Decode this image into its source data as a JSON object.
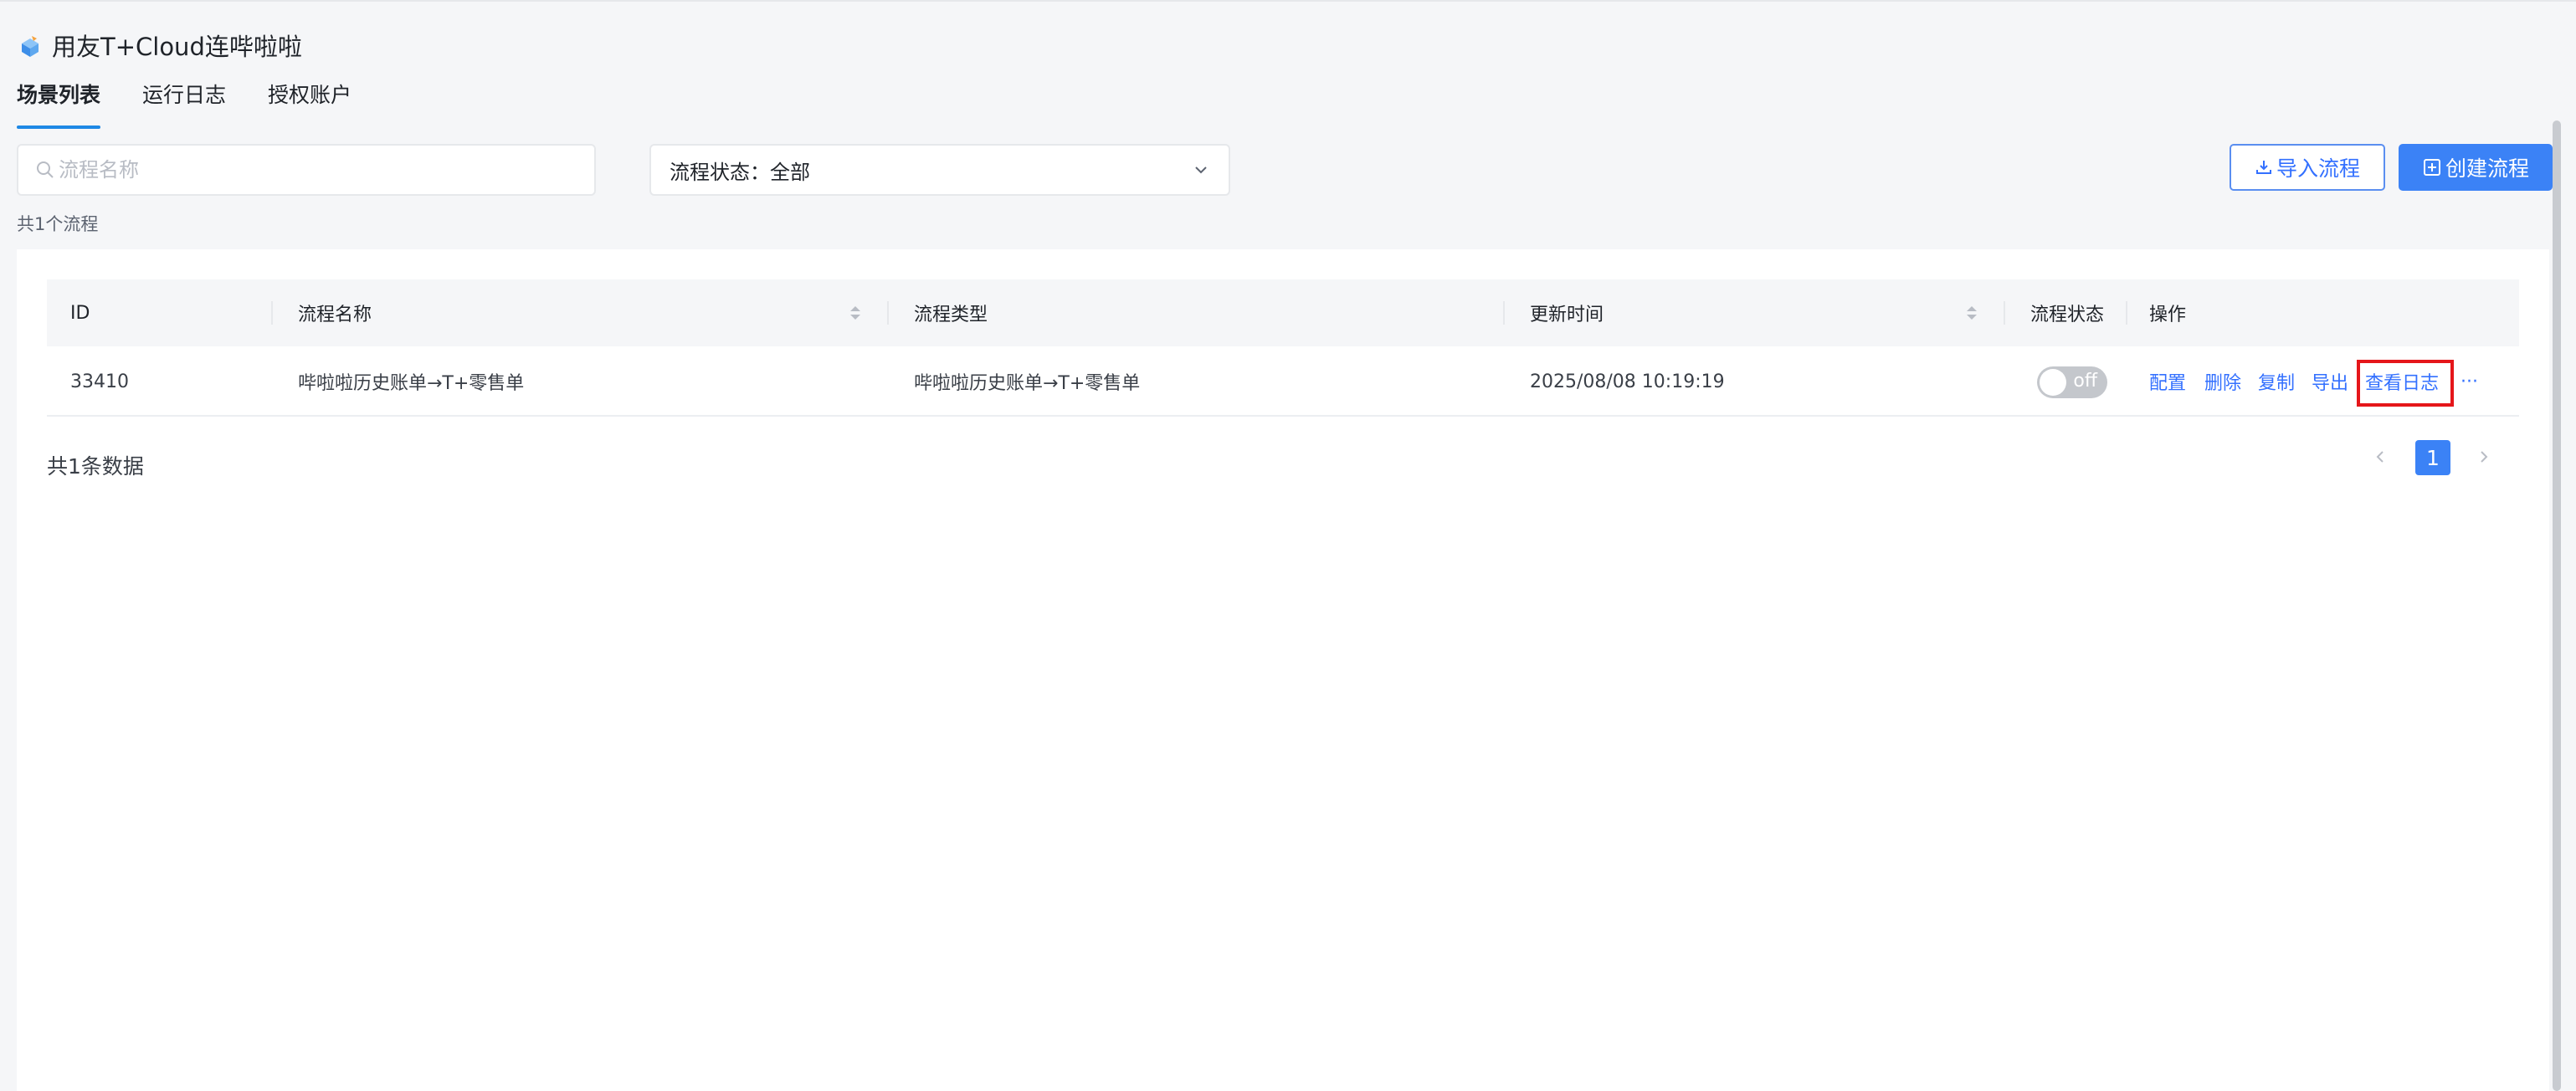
{
  "app": {
    "title": "用友T+Cloud连哔啦啦"
  },
  "tabs": [
    {
      "label": "场景列表",
      "active": true
    },
    {
      "label": "运行日志",
      "active": false
    },
    {
      "label": "授权账户",
      "active": false
    }
  ],
  "filters": {
    "search_placeholder": "流程名称",
    "status_select": "流程状态：全部"
  },
  "toolbar": {
    "import_label": "导入流程",
    "create_label": "创建流程"
  },
  "summary": {
    "flow_count": "共1个流程"
  },
  "table": {
    "columns": [
      "ID",
      "流程名称",
      "流程类型",
      "更新时间",
      "流程状态",
      "操作"
    ],
    "rows": [
      {
        "id": "33410",
        "name": "哔啦啦历史账单→T+零售单",
        "type": "哔啦啦历史账单→T+零售单",
        "updated": "2025/08/08 10:19:19",
        "status": "off",
        "actions": [
          "配置",
          "删除",
          "复制",
          "导出",
          "查看日志",
          "···"
        ]
      }
    ]
  },
  "pagination": {
    "total": "共1条数据",
    "current_page": "1"
  },
  "colors": {
    "accent": "#3b82f6",
    "link": "#3370ff",
    "highlight": "#e5161a",
    "tab_underline": "#1e88e5"
  }
}
